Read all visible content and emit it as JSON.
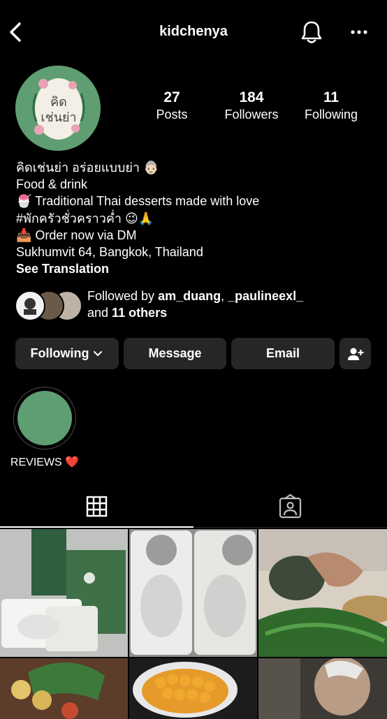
{
  "header": {
    "username": "kidchenya",
    "back_icon": "chevron-left-icon",
    "notification_icon": "bell-icon",
    "more_icon": "ellipsis-icon"
  },
  "profile": {
    "avatar_text": "คิดเช่นย่า",
    "stats": [
      {
        "value": "27",
        "label": "Posts"
      },
      {
        "value": "184",
        "label": "Followers"
      },
      {
        "value": "11",
        "label": "Following"
      }
    ]
  },
  "bio": {
    "name": "คิดเช่นย่า อร่อยแบบย่า 👵🏻",
    "category": "Food & drink",
    "line1": "🍧 Traditional Thai desserts made with love",
    "line2": "#พักครัวชั่วคราวค่ำ 😉🙏",
    "line3": "📥 Order now via DM",
    "address": "Sukhumvit 64, Bangkok, Thailand",
    "see_translation": "See Translation"
  },
  "followed_by": {
    "prefix": "Followed by ",
    "user1": "am_duang",
    "sep": ", ",
    "user2": "_paulineexl_",
    "and": "and ",
    "others": "11 others"
  },
  "buttons": {
    "following": "Following",
    "message": "Message",
    "email": "Email",
    "add_user_icon": "add-user-icon"
  },
  "highlights": [
    {
      "label": "REVIEWS ❤️",
      "color": "#5f9e72"
    }
  ],
  "tabs": {
    "grid_icon": "grid-icon",
    "tagged_icon": "tagged-person-icon",
    "active": "grid"
  },
  "colors": {
    "background": "#000000",
    "button_bg": "#262626",
    "brand_green": "#5f9e72"
  }
}
